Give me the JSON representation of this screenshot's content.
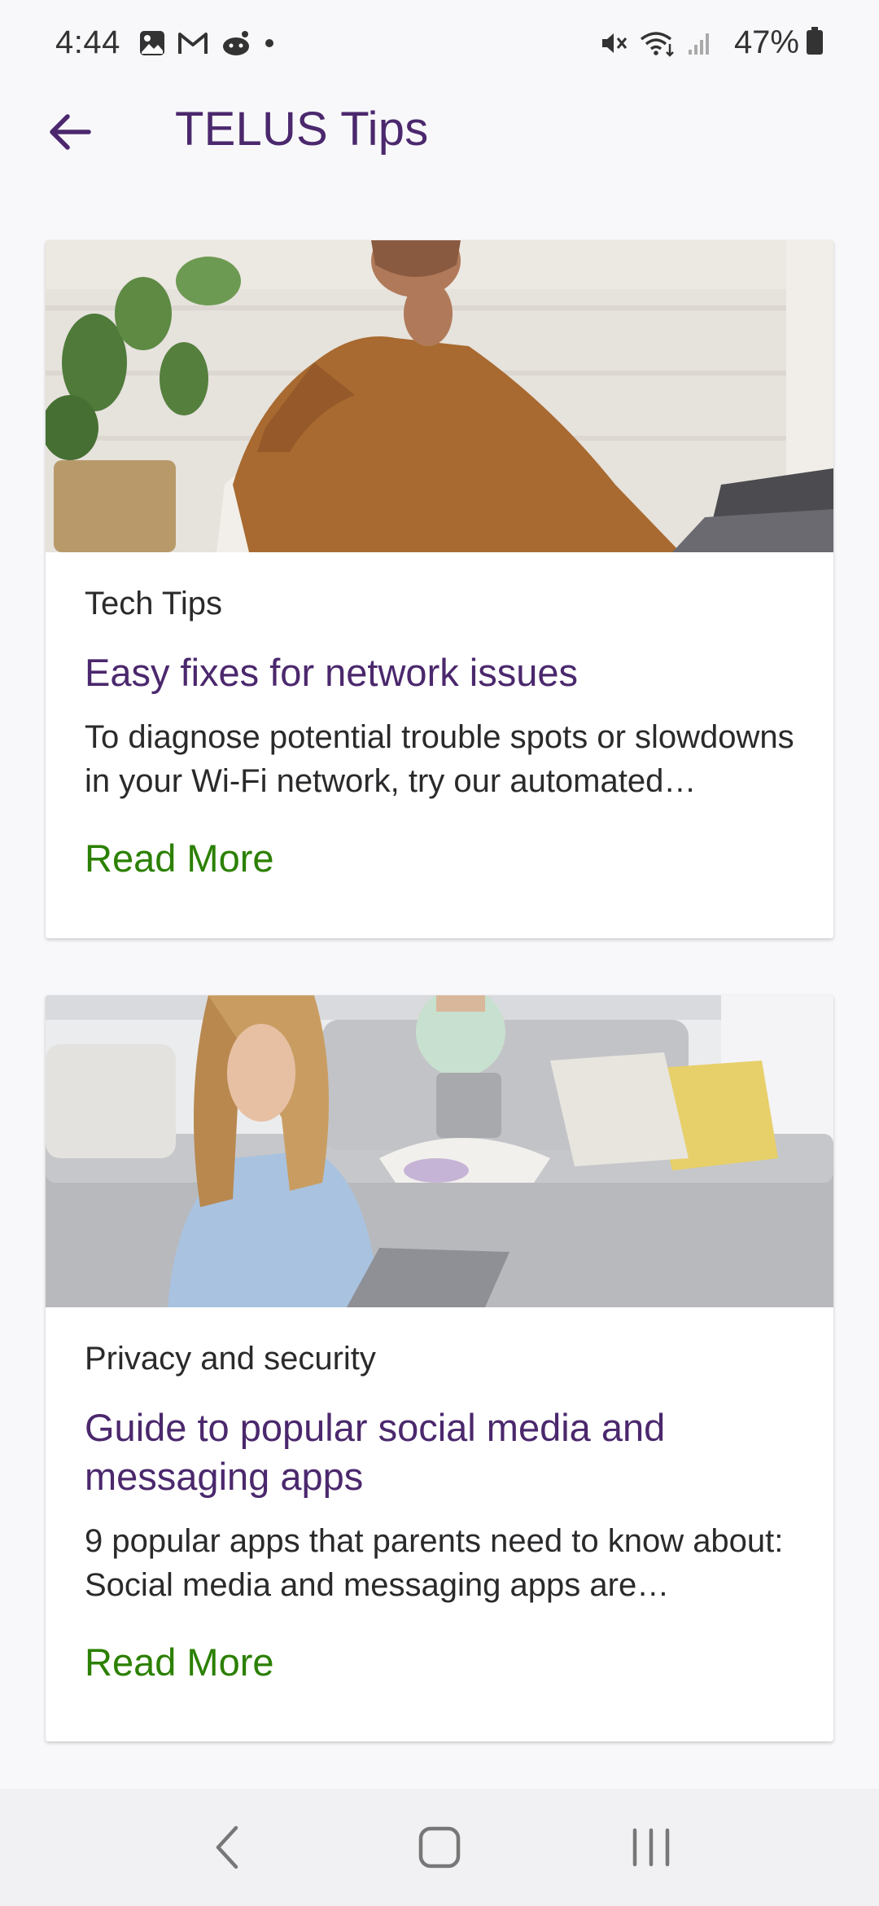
{
  "status_bar": {
    "time": "4:44",
    "battery": "47%"
  },
  "app_bar": {
    "title": "TELUS Tips"
  },
  "cards": [
    {
      "category": "Tech Tips",
      "headline": "Easy fixes for network issues",
      "description": "To diagnose potential trouble spots or slowdowns in your Wi-Fi network, try our automated troubleshooting tool.",
      "read_more": "Read More"
    },
    {
      "category": "Privacy and security",
      "headline": "Guide to popular social media and messaging apps",
      "description": "9 popular apps that parents need to know about: Social media and messaging apps are everywhere.",
      "read_more": "Read More"
    }
  ],
  "colors": {
    "brand_purple": "#4b286d",
    "link_green": "#2b8000",
    "background": "#f8f8fa"
  }
}
